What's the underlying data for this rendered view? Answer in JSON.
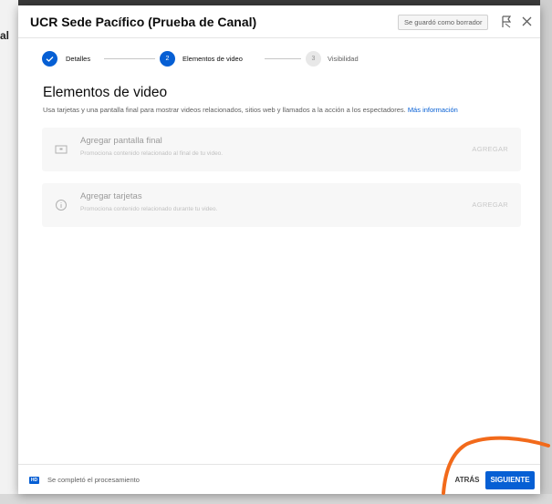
{
  "backdrop": {
    "peek_text": "al"
  },
  "dialog": {
    "title": "UCR Sede Pacífico (Prueba de Canal)",
    "draft_badge": "Se guardó como borrador"
  },
  "stepper": {
    "steps": [
      {
        "number": "",
        "label": "Detalles",
        "state": "done"
      },
      {
        "number": "2",
        "label": "Elementos de video",
        "state": "active"
      },
      {
        "number": "3",
        "label": "Visibilidad",
        "state": "pending"
      }
    ]
  },
  "section": {
    "title": "Elementos de video",
    "description": "Usa tarjetas y una pantalla final para mostrar videos relacionados, sitios web y llamados a la acción a los espectadores.",
    "link": "Más información"
  },
  "cards": [
    {
      "icon": "end-screen-icon",
      "title": "Agregar pantalla final",
      "subtitle": "Promociona contenido relacionado al final de tu video.",
      "action": "AGREGAR"
    },
    {
      "icon": "info-icon",
      "title": "Agregar tarjetas",
      "subtitle": "Promociona contenido relacionado durante tu video.",
      "action": "AGREGAR"
    }
  ],
  "footer": {
    "badge": "HD",
    "status": "Se completó el procesamiento",
    "back_label": "ATRÁS",
    "next_label": "SIGUIENTE"
  },
  "colors": {
    "accent": "#065fd4",
    "annotation": "#f26a1b"
  }
}
